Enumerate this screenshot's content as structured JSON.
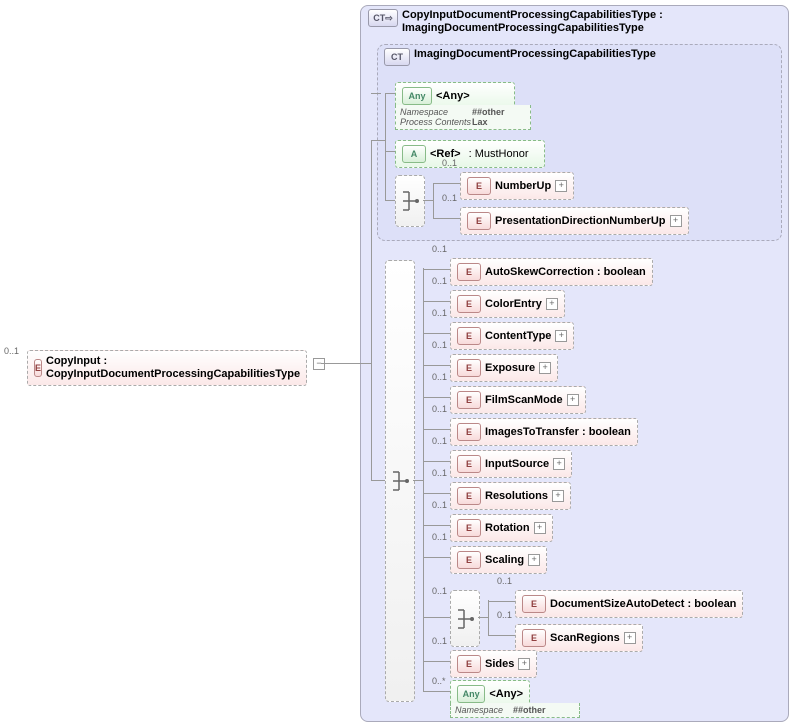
{
  "root": {
    "occ": "0..1",
    "label": "CopyInput : CopyInputDocumentProcessingCapabilitiesType"
  },
  "extType": {
    "label": "CopyInputDocumentProcessingCapabilitiesType : ImagingDocumentProcessingCapabilitiesType"
  },
  "baseType": {
    "label": "ImagingDocumentProcessingCapabilitiesType"
  },
  "any1": {
    "label": "<Any>",
    "nsKey": "Namespace",
    "nsVal": "##other",
    "pcKey": "Process Contents",
    "pcVal": "Lax"
  },
  "attr": {
    "label": "<Ref>",
    "type": ": MustHonor"
  },
  "innerSeq": {
    "items": [
      {
        "occ": "0..1",
        "label": "NumberUp"
      },
      {
        "occ": "0..1",
        "label": "PresentationDirectionNumberUp"
      }
    ]
  },
  "mainSeq": {
    "items": [
      {
        "occ": "0..1",
        "label": "AutoSkewCorrection : boolean"
      },
      {
        "occ": "0..1",
        "label": "ColorEntry",
        "exp": true
      },
      {
        "occ": "0..1",
        "label": "ContentType",
        "exp": true
      },
      {
        "occ": "0..1",
        "label": "Exposure",
        "exp": true
      },
      {
        "occ": "0..1",
        "label": "FilmScanMode",
        "exp": true
      },
      {
        "occ": "0..1",
        "label": "ImagesToTransfer : boolean"
      },
      {
        "occ": "0..1",
        "label": "InputSource",
        "exp": true
      },
      {
        "occ": "0..1",
        "label": "Resolutions",
        "exp": true
      },
      {
        "occ": "0..1",
        "label": "Rotation",
        "exp": true
      },
      {
        "occ": "0..1",
        "label": "Scaling",
        "exp": true
      }
    ],
    "subSeq": {
      "occ": "0..1",
      "items": [
        {
          "occ": "0..1",
          "label": "DocumentSizeAutoDetect : boolean"
        },
        {
          "occ": "0..1",
          "label": "ScanRegions",
          "exp": true
        }
      ]
    },
    "after": [
      {
        "occ": "0..1",
        "label": "Sides",
        "exp": true
      }
    ],
    "any2": {
      "occ": "0..*",
      "label": "<Any>",
      "nsKey": "Namespace",
      "nsVal": "##other"
    }
  }
}
